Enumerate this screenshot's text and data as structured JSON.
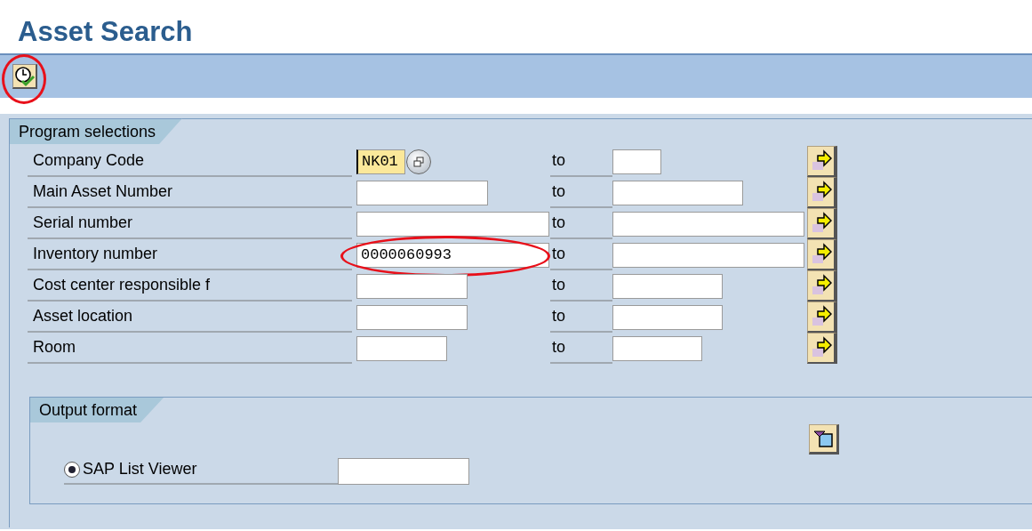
{
  "title": "Asset Search",
  "toolbar": {
    "execute_button": {
      "circled": true
    }
  },
  "program_selections": {
    "title": "Program selections",
    "rows": [
      {
        "label": "Company Code",
        "value": "NK01",
        "focused": true,
        "search_help": true,
        "circled": false,
        "to": "to"
      },
      {
        "label": "Main Asset Number",
        "focused": false,
        "search_help": false,
        "circled": false,
        "to": "to"
      },
      {
        "label": "Serial number",
        "focused": false,
        "search_help": false,
        "circled": false,
        "to": "to"
      },
      {
        "label": "Inventory number",
        "value": "0000060993",
        "focused": false,
        "search_help": false,
        "circled": true,
        "to": "to"
      },
      {
        "label": "Cost center responsible f",
        "focused": false,
        "search_help": false,
        "circled": false,
        "to": "to"
      },
      {
        "label": "Asset location",
        "focused": false,
        "search_help": false,
        "circled": false,
        "to": "to"
      },
      {
        "label": "Room",
        "focused": false,
        "search_help": false,
        "circled": false,
        "to": "to"
      }
    ]
  },
  "output_format": {
    "title": "Output format",
    "options": [
      {
        "label": "SAP List Viewer",
        "selected": true
      }
    ]
  }
}
